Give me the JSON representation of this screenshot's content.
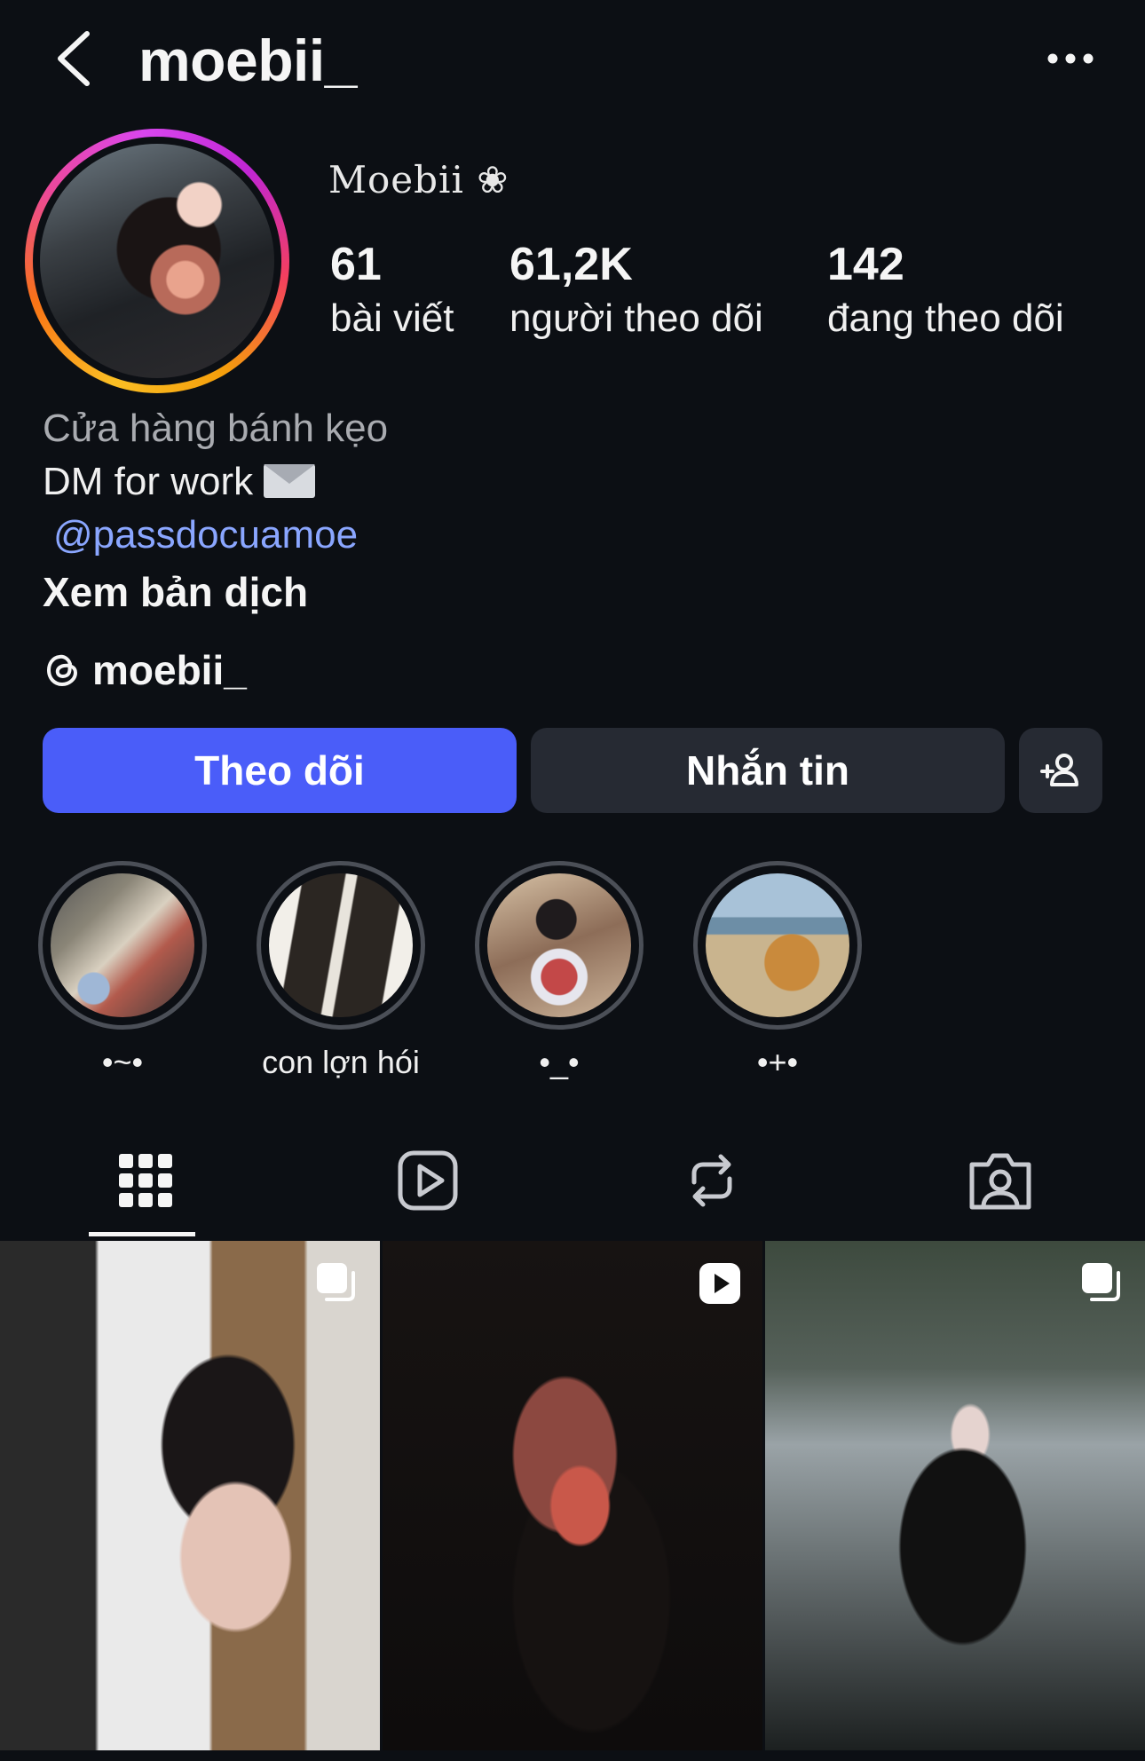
{
  "header": {
    "username": "moebii_"
  },
  "profile": {
    "display_name": "Moebii ❀",
    "stats": [
      {
        "value": "61",
        "label": "bài viết"
      },
      {
        "value": "61,2K",
        "label": "người theo dõi"
      },
      {
        "value": "142",
        "label": "đang theo dõi"
      }
    ],
    "category": "Cửa hàng bánh kẹo",
    "bio_line": "DM for work",
    "mention": "@passdocuamoe",
    "translate_label": "Xem bản dịch",
    "threads_handle": "moebii_"
  },
  "actions": {
    "follow_label": "Theo dõi",
    "message_label": "Nhắn tin"
  },
  "highlights": [
    {
      "label": "•~•"
    },
    {
      "label": "con lợn hói"
    },
    {
      "label": "•_•"
    },
    {
      "label": "•+•"
    }
  ],
  "tabs": [
    {
      "icon": "grid-icon"
    },
    {
      "icon": "reels-icon"
    },
    {
      "icon": "reposts-icon"
    },
    {
      "icon": "tagged-icon"
    }
  ],
  "posts": [
    {
      "badge": "carousel-icon"
    },
    {
      "badge": "reel-icon"
    },
    {
      "badge": "carousel-icon"
    }
  ]
}
